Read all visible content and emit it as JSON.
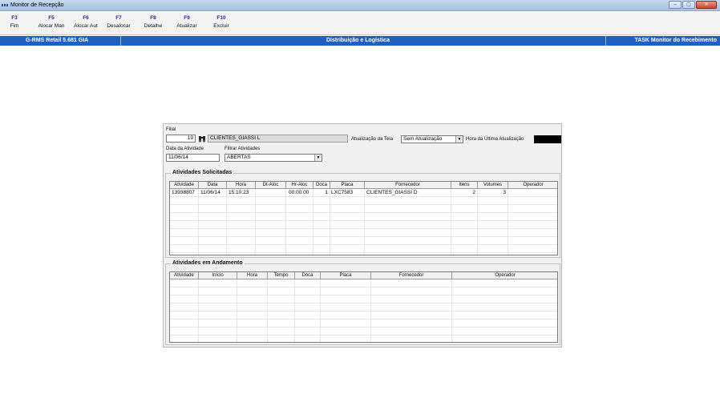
{
  "window": {
    "title": "Monitor de Recepção",
    "controls": [
      "–",
      "▢",
      "✕"
    ]
  },
  "toolbar": {
    "buttons": [
      {
        "key": "F3",
        "label": "Fim"
      },
      {
        "key": "F5",
        "label": "Alocar Man"
      },
      {
        "key": "F6",
        "label": "Alocar Aut"
      },
      {
        "key": "F7",
        "label": "Desalocar"
      },
      {
        "key": "F8",
        "label": "Detalhe"
      },
      {
        "key": "F9",
        "label": "Atualizar"
      },
      {
        "key": "F10",
        "label": "Excluir"
      }
    ]
  },
  "status": {
    "left": "G-RMS Retail 5.681 GIA",
    "center": "Distribuição e Logística",
    "right": "TASK Monitor do Recebimento"
  },
  "form": {
    "filial_label": "Filial",
    "filial_value": "19",
    "filial_name": "CLIENTES_GIASSI L",
    "atualizacao_label": "Atualização da Tela",
    "atualizacao_value": "Sem Atualização",
    "hora_label": "Hora da Última Atualização",
    "data_label": "Data da Atividade",
    "data_value": "11/06/14",
    "filtrar_label": "Filtrar Atividades",
    "filtrar_value": "ABERTAS"
  },
  "solicitadas": {
    "title": "Atividades Solicitadas",
    "columns": [
      "Atividade",
      "Data",
      "Hora",
      "Dt-Aloc",
      "Hr-Aloc",
      "Doca",
      "Placa",
      "Fornecedor",
      "Itens",
      "Volumes",
      "Operador"
    ],
    "rows": [
      [
        "13938807",
        "11/06/14",
        "15:10:23",
        "",
        "00:00:00",
        "1",
        "LXC7583",
        "CLIENTES_GIASSI D",
        "2",
        "3",
        ""
      ]
    ]
  },
  "andamento": {
    "title": "Atividades em Andamento",
    "columns": [
      "Atividade",
      "Início",
      "Hora",
      "Tempo",
      "Doca",
      "Placa",
      "Fornecedor",
      "Operador"
    ],
    "rows": []
  },
  "colors": {
    "statusbar": "#1f5fbf",
    "toolbar_key": "#1a2a8c"
  },
  "icons": {
    "app": "app-icon",
    "search": "binoculars-icon",
    "dropdown": "chevron-down-icon"
  }
}
